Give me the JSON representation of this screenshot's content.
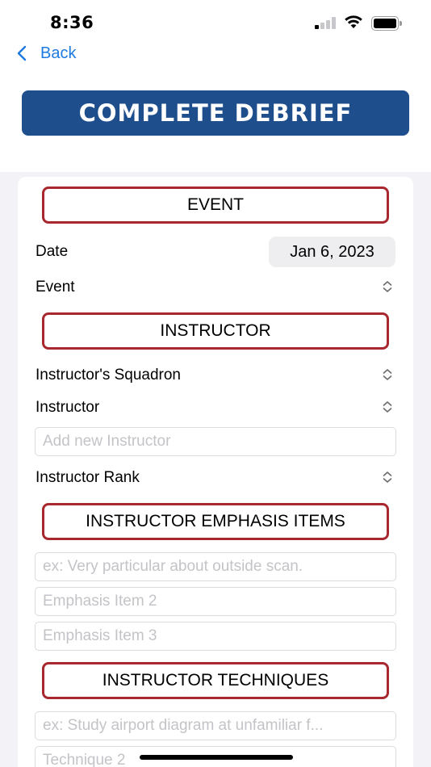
{
  "status_bar": {
    "time": "8:36"
  },
  "nav": {
    "back_label": "Back"
  },
  "header": {
    "title": "COMPLETE DEBRIEF"
  },
  "sections": {
    "event": "EVENT",
    "instructor": "INSTRUCTOR",
    "emphasis": "INSTRUCTOR EMPHASIS ITEMS",
    "techniques": "INSTRUCTOR TECHNIQUES"
  },
  "event_section": {
    "date_label": "Date",
    "date_value": "Jan 6, 2023",
    "event_label": "Event"
  },
  "instructor_section": {
    "squadron_label": "Instructor's Squadron",
    "instructor_label": "Instructor",
    "new_instructor_placeholder": "Add new Instructor",
    "rank_label": "Instructor Rank"
  },
  "emphasis_section": {
    "item1_placeholder": "ex: Very particular about outside scan.",
    "item2_placeholder": "Emphasis Item 2",
    "item3_placeholder": "Emphasis Item 3"
  },
  "techniques_section": {
    "technique1_placeholder": "ex: Study airport diagram at unfamiliar f...",
    "technique2_placeholder": "Technique 2"
  },
  "colors": {
    "accent": "#1f7ae0",
    "banner": "#1f4e8c",
    "section_border": "#a8282f",
    "background": "#f2f2f7"
  }
}
